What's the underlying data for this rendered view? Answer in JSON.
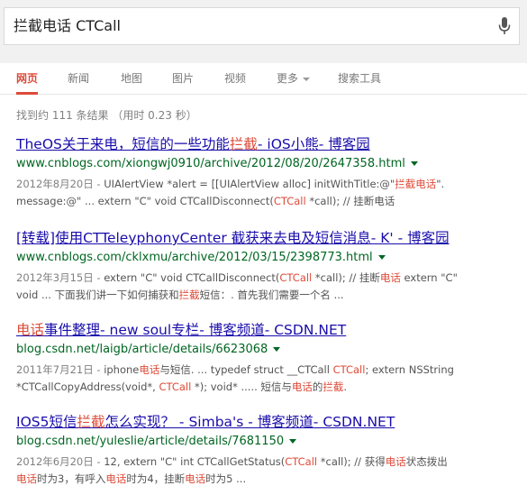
{
  "search": {
    "query": "拦截电话 CTCall",
    "mic_icon": "microphone-icon"
  },
  "tabs": [
    {
      "label": "网页",
      "active": true
    },
    {
      "label": "新闻"
    },
    {
      "label": "地图"
    },
    {
      "label": "图片"
    },
    {
      "label": "视频"
    },
    {
      "label": "更多"
    },
    {
      "label": "搜索工具"
    }
  ],
  "stats": {
    "text": "找到约 111 条结果 （用时 0.23 秒）"
  },
  "results": [
    {
      "title": [
        {
          "t": "TheOS关于来电，短信的一些功能"
        },
        {
          "t": "拦截",
          "hl": true
        },
        {
          "t": "- iOS小熊- 博客园"
        }
      ],
      "url": "www.cnblogs.com/xiongwj0910/archive/2012/08/20/2647358.html",
      "lines": [
        [
          {
            "t": "2012年8月20日 - ",
            "date": true
          },
          {
            "t": "UIAlertView *alert = [[UIAlertView alloc] initWithTitle:@\""
          },
          {
            "t": "拦截电话",
            "hl": true
          },
          {
            "t": "\"."
          }
        ],
        [
          {
            "t": "message:@\" ... extern \"C\" void CTCallDisconnect("
          },
          {
            "t": "CTCall",
            "hl": true
          },
          {
            "t": " *call); // 挂断电话"
          }
        ]
      ]
    },
    {
      "title": [
        {
          "t": "[转载]使用CTTeleyphonyCenter 截获来去电及短信消息- K' - 博客园"
        }
      ],
      "url": "www.cnblogs.com/cklxmu/archive/2012/03/15/2398773.html",
      "lines": [
        [
          {
            "t": "2012年3月15日 - ",
            "date": true
          },
          {
            "t": "extern \"C\" void CTCallDisconnect("
          },
          {
            "t": "CTCall",
            "hl": true
          },
          {
            "t": " *call); // 挂断"
          },
          {
            "t": "电话",
            "hl": true
          },
          {
            "t": " extern \"C\""
          }
        ],
        [
          {
            "t": "void ... 下面我们讲一下如何捕获和"
          },
          {
            "t": "拦截",
            "hl": true
          },
          {
            "t": "短信：. 首先我们需要一个名 ..."
          }
        ]
      ]
    },
    {
      "title": [
        {
          "t": "电话",
          "hl": true
        },
        {
          "t": "事件整理- new soul专栏- 博客频道- CSDN.NET"
        }
      ],
      "url": "blog.csdn.net/laigb/article/details/6623068",
      "lines": [
        [
          {
            "t": "2011年7月21日 - ",
            "date": true
          },
          {
            "t": "iphone"
          },
          {
            "t": "电话",
            "hl": true
          },
          {
            "t": "与短信. ... typedef struct __CTCall "
          },
          {
            "t": "CTCall",
            "hl": true
          },
          {
            "t": "; extern NSString"
          }
        ],
        [
          {
            "t": "*CTCallCopyAddress(void*, "
          },
          {
            "t": "CTCall",
            "hl": true
          },
          {
            "t": " *); void* ..... 短信与"
          },
          {
            "t": "电话",
            "hl": true
          },
          {
            "t": "的"
          },
          {
            "t": "拦截",
            "hl": true
          },
          {
            "t": "."
          }
        ]
      ]
    },
    {
      "title": [
        {
          "t": "IOS5短信"
        },
        {
          "t": "拦截",
          "hl": true
        },
        {
          "t": "怎么实现？ - Simba's - 博客频道- CSDN.NET"
        }
      ],
      "url": "blog.csdn.net/yuleslie/article/details/7681150",
      "lines": [
        [
          {
            "t": "2012年6月20日 - ",
            "date": true
          },
          {
            "t": "12, extern \"C\" int CTCallGetStatus("
          },
          {
            "t": "CTCall",
            "hl": true
          },
          {
            "t": " *call); // 获得"
          },
          {
            "t": "电话",
            "hl": true
          },
          {
            "t": "状态拨出"
          }
        ],
        [
          {
            "t": "电话",
            "hl": true
          },
          {
            "t": "时为3，有呼入"
          },
          {
            "t": "电话",
            "hl": true
          },
          {
            "t": "时为4，挂断"
          },
          {
            "t": "电话",
            "hl": true
          },
          {
            "t": "时为5 ..."
          }
        ]
      ]
    }
  ]
}
